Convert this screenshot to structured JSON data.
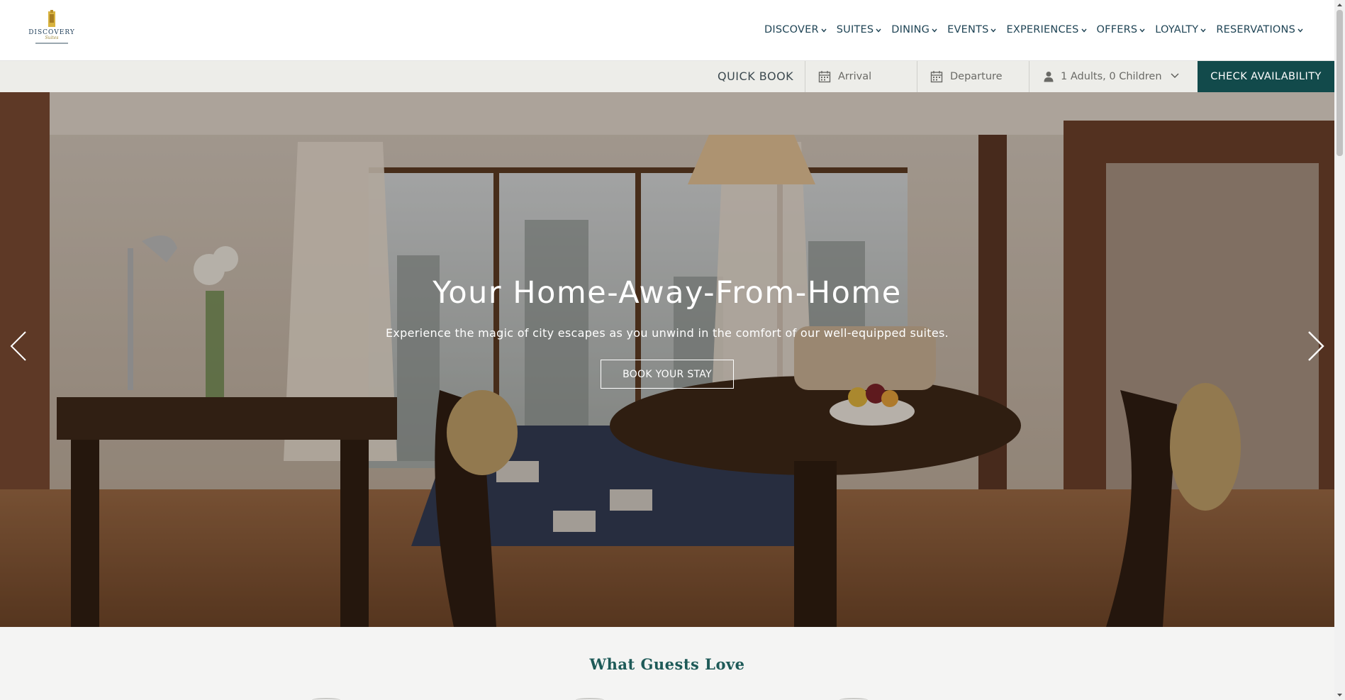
{
  "brand": {
    "logo_text": "DISCOVERY",
    "logo_script": "Suites"
  },
  "nav": {
    "items": [
      {
        "label": "DISCOVER"
      },
      {
        "label": "SUITES"
      },
      {
        "label": "DINING"
      },
      {
        "label": "EVENTS"
      },
      {
        "label": "EXPERIENCES"
      },
      {
        "label": "OFFERS"
      },
      {
        "label": "LOYALTY"
      },
      {
        "label": "RESERVATIONS"
      }
    ]
  },
  "quick_book": {
    "label": "QUICK BOOK",
    "arrival_placeholder": "Arrival",
    "departure_placeholder": "Departure",
    "guests_value": "1 Adults, 0 Children",
    "button_label": "CHECK AVAILABILITY"
  },
  "hero": {
    "title": "Your Home-Away-From-Home",
    "subtitle": "Experience the magic of city escapes as you unwind in the comfort of our well-equipped suites.",
    "cta_label": "BOOK YOUR STAY"
  },
  "section": {
    "title": "What Guests Love"
  },
  "icons": {
    "chevron": "chevron-down-icon",
    "calendar": "calendar-icon",
    "user": "user-icon",
    "prev": "arrow-left-icon",
    "next": "arrow-right-icon"
  },
  "colors": {
    "accent": "#124a4b",
    "nav_text": "#1f4455",
    "section_title": "#1e5a58"
  }
}
